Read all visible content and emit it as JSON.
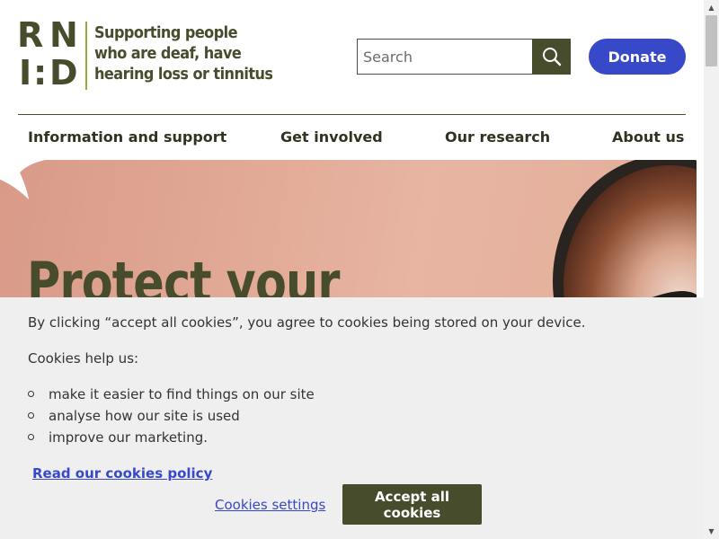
{
  "logo": {
    "letters": [
      "R",
      "N",
      "I",
      ":",
      "D"
    ],
    "tagline_lines": [
      "Supporting people",
      "who are deaf, have",
      "hearing loss or tinnitus"
    ]
  },
  "search": {
    "placeholder": "Search",
    "value": "",
    "button_icon": "search-icon"
  },
  "donate_label": "Donate",
  "nav": {
    "items": [
      {
        "label": "Information and support"
      },
      {
        "label": "Get involved"
      },
      {
        "label": "Our research"
      },
      {
        "label": "About us"
      }
    ]
  },
  "hero": {
    "title": "Protect your"
  },
  "cookie_banner": {
    "intro": "By clicking “accept all cookies”, you agree to cookies being stored on your device.",
    "help_heading": "Cookies help us:",
    "list": [
      "make it easier to find things on our site",
      "analyse how our site is used",
      "improve our marketing."
    ],
    "policy_link": "Read our cookies policy",
    "settings_link": "Cookies settings",
    "accept_label": "Accept all cookies"
  },
  "colors": {
    "brand_olive": "#474c2c",
    "accent_green": "#8fb13a",
    "donate_blue": "#3748c9",
    "banner_bg": "#efefef"
  }
}
